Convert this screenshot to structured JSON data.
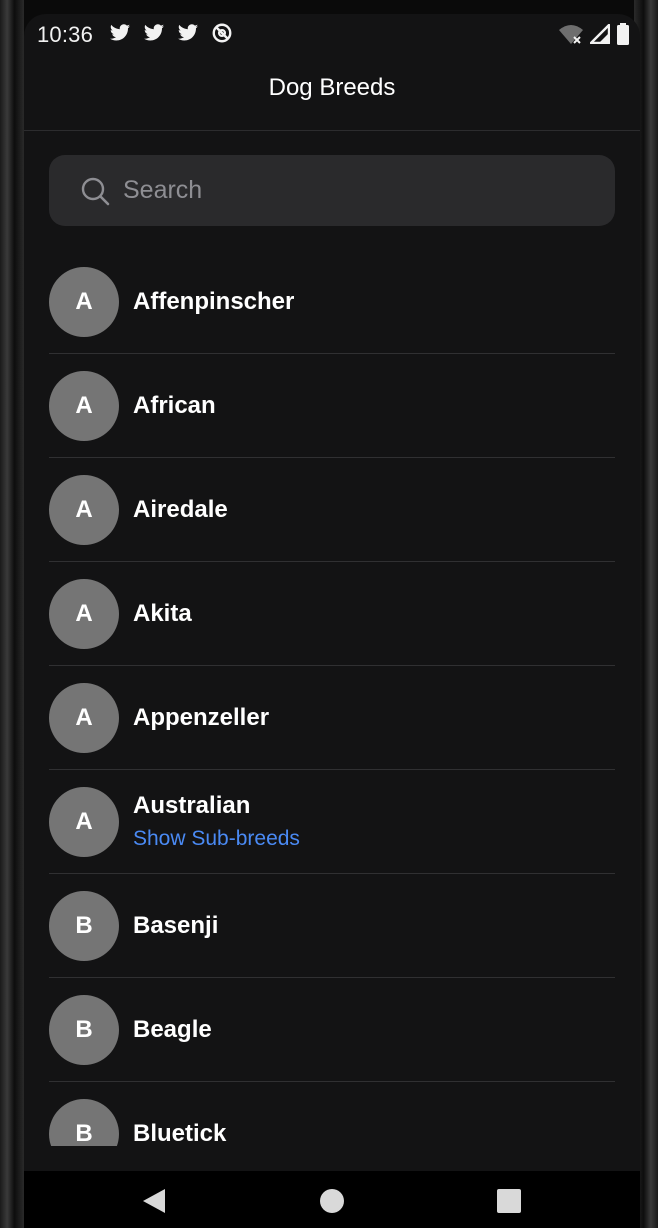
{
  "status_bar": {
    "time": "10:36",
    "left_icons": [
      "twitter-icon",
      "twitter-icon",
      "twitter-icon",
      "no-disturb-icon"
    ],
    "right_icons": [
      "wifi-off-icon",
      "cell-signal-icon",
      "battery-icon"
    ]
  },
  "app_bar": {
    "title": "Dog Breeds"
  },
  "search": {
    "placeholder": "Search",
    "value": ""
  },
  "breeds": [
    {
      "letter": "A",
      "name": "Affenpinscher",
      "sub_label": ""
    },
    {
      "letter": "A",
      "name": "African",
      "sub_label": ""
    },
    {
      "letter": "A",
      "name": "Airedale",
      "sub_label": ""
    },
    {
      "letter": "A",
      "name": "Akita",
      "sub_label": ""
    },
    {
      "letter": "A",
      "name": "Appenzeller",
      "sub_label": ""
    },
    {
      "letter": "A",
      "name": "Australian",
      "sub_label": "Show Sub-breeds"
    },
    {
      "letter": "B",
      "name": "Basenji",
      "sub_label": ""
    },
    {
      "letter": "B",
      "name": "Beagle",
      "sub_label": ""
    },
    {
      "letter": "B",
      "name": "Bluetick",
      "sub_label": ""
    }
  ],
  "nav_bar": {
    "buttons": [
      "back-icon",
      "home-icon",
      "recents-icon"
    ]
  },
  "colors": {
    "background": "#131314",
    "search_background": "#2a2a2c",
    "avatar": "#757575",
    "link": "#4a8af4",
    "divider": "#303032"
  }
}
